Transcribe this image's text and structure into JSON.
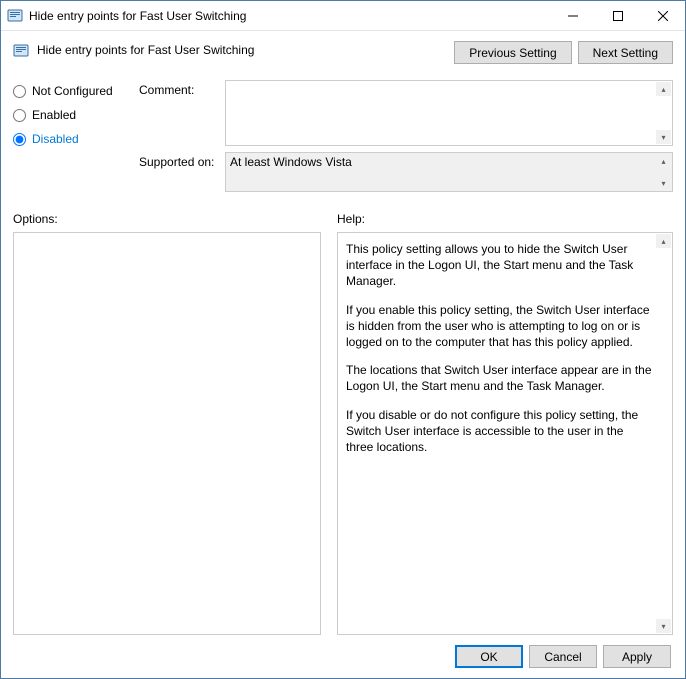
{
  "window": {
    "title": "Hide entry points for Fast User Switching"
  },
  "header": {
    "policy_title": "Hide entry points for Fast User Switching",
    "previous_button": "Previous Setting",
    "next_button": "Next Setting"
  },
  "state": {
    "not_configured_label": "Not Configured",
    "enabled_label": "Enabled",
    "disabled_label": "Disabled",
    "selected": "disabled"
  },
  "fields": {
    "comment_label": "Comment:",
    "comment_value": "",
    "supported_label": "Supported on:",
    "supported_value": "At least Windows Vista"
  },
  "panels": {
    "options_label": "Options:",
    "help_label": "Help:"
  },
  "help": {
    "p1": "This policy setting allows you to hide the Switch User interface in the Logon UI, the Start menu and the Task Manager.",
    "p2": "If you enable this policy setting, the Switch User interface is hidden from the user who is attempting to log on or is logged on to the computer that has this policy applied.",
    "p3": "The locations that Switch User interface appear are in the Logon UI, the Start menu and the Task Manager.",
    "p4": "If you disable or do not configure this policy setting, the Switch User interface is accessible to the user in the three locations."
  },
  "footer": {
    "ok": "OK",
    "cancel": "Cancel",
    "apply": "Apply"
  }
}
